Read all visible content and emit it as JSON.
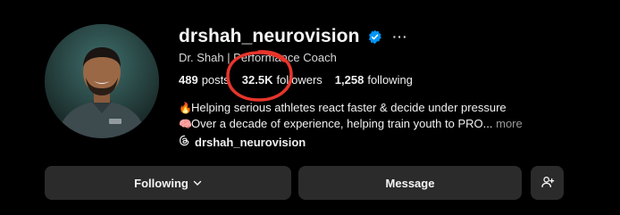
{
  "profile": {
    "username": "drshah_neurovision",
    "full_name": "Dr. Shah | Performance Coach",
    "stats": {
      "posts_count": "489",
      "posts_label": "posts",
      "followers_count": "32.5K",
      "followers_label": "followers",
      "following_count": "1,258",
      "following_label": "following"
    },
    "bio": {
      "line1_emoji": "🔥",
      "line1": "Helping serious athletes react faster & decide under pressure",
      "line2_emoji": "🧠",
      "line2": "Over a decade of experience, helping train youth to PRO...",
      "more_label": "more"
    },
    "threads_handle": "drshah_neurovision",
    "more_options": "···"
  },
  "actions": {
    "following_label": "Following",
    "message_label": "Message"
  },
  "colors": {
    "background": "#000000",
    "button": "#2b2b2b",
    "verified": "#0095f6",
    "annotation": "#e8352b"
  }
}
